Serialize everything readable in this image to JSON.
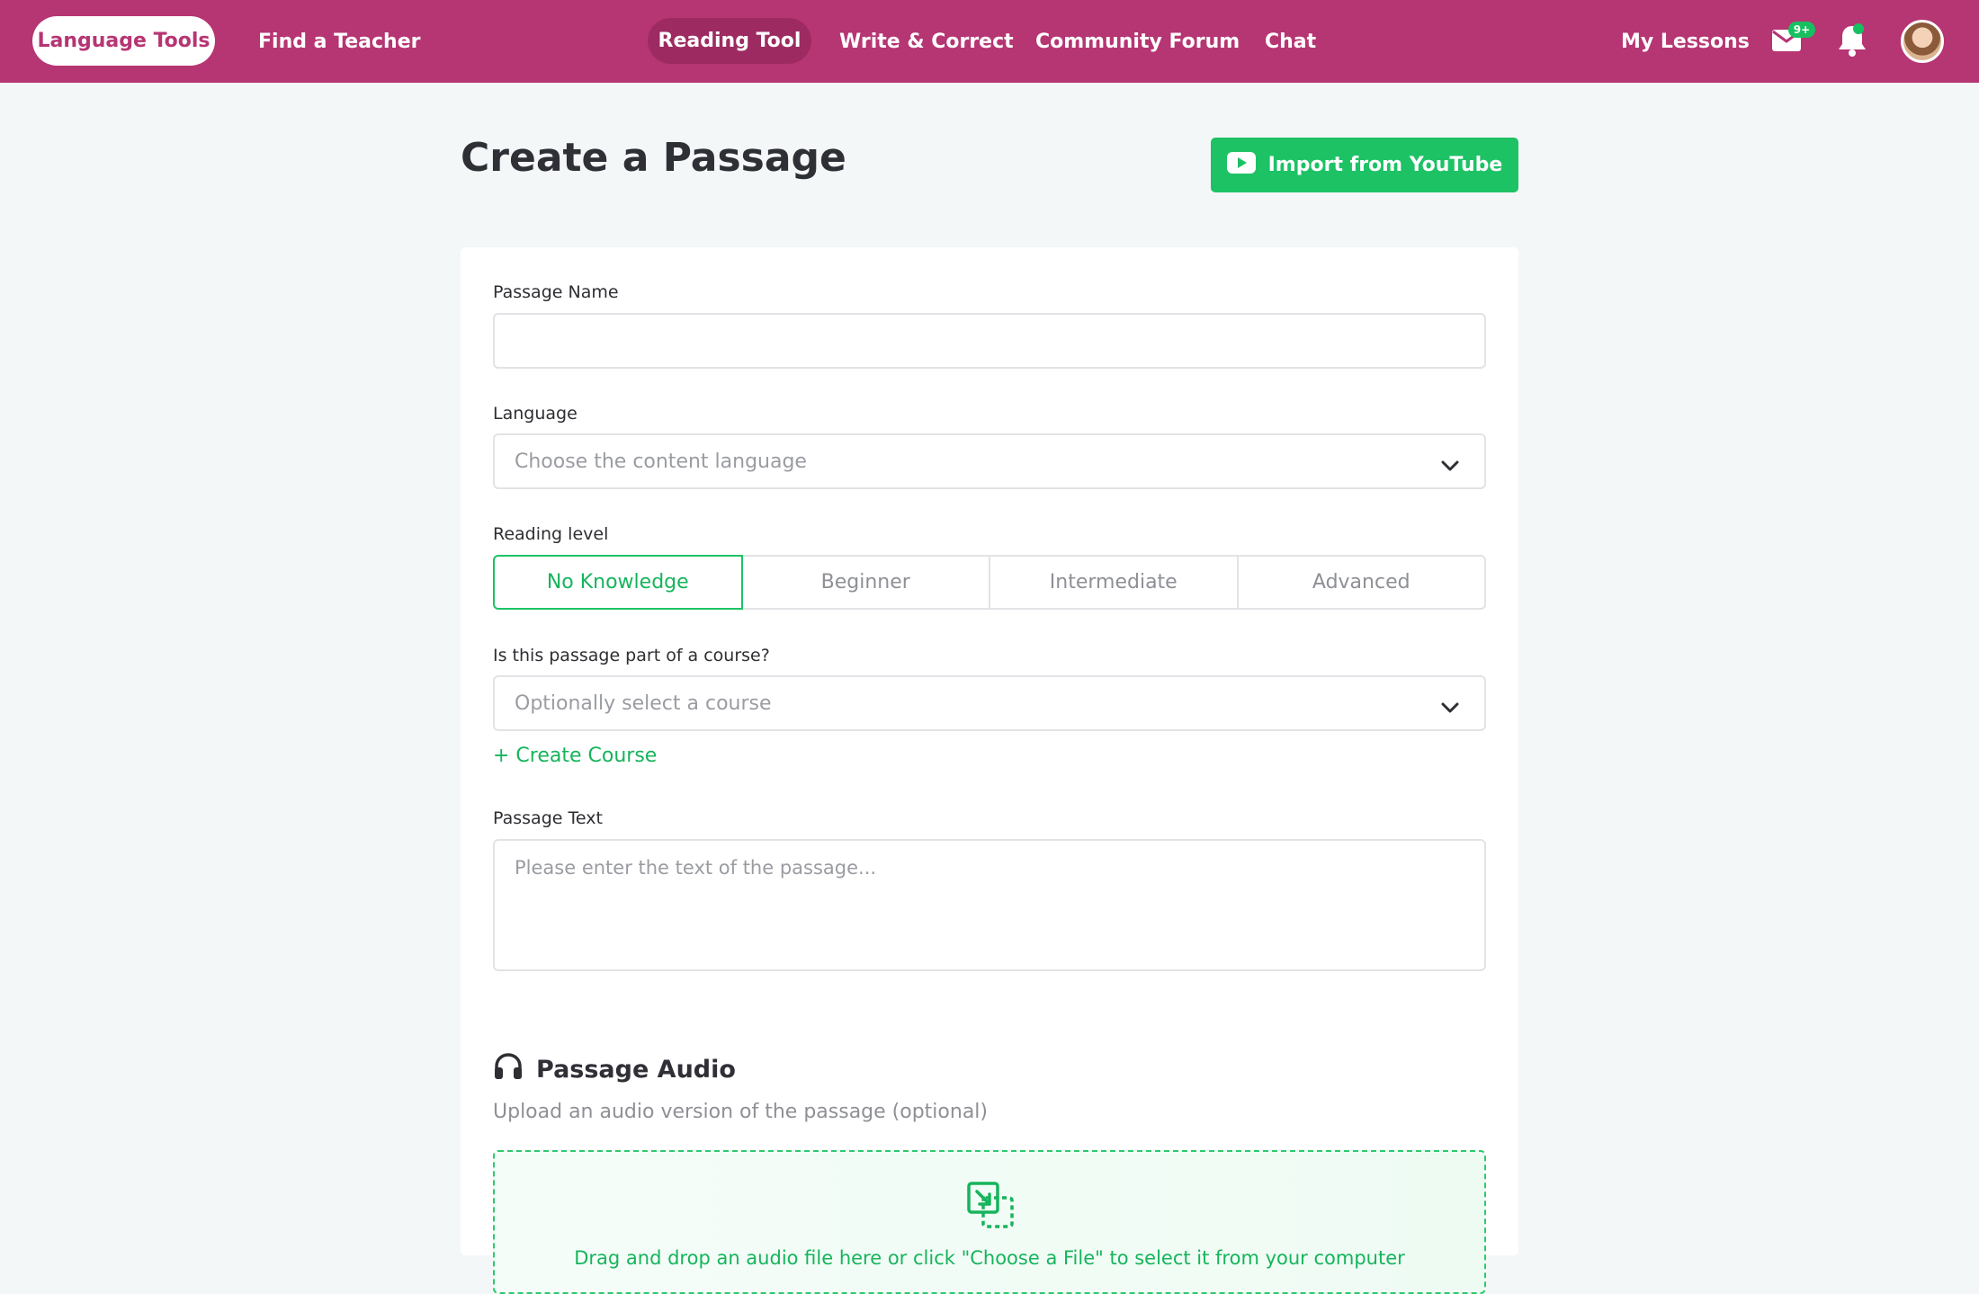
{
  "nav": {
    "brand": "Language Tools",
    "find_teacher": "Find a Teacher",
    "reading_tool": "Reading Tool",
    "write_correct": "Write & Correct",
    "community_forum": "Community Forum",
    "chat": "Chat",
    "my_lessons": "My Lessons",
    "messages_badge": "9+",
    "icons": [
      "mail-icon",
      "bell-icon",
      "avatar"
    ]
  },
  "page": {
    "title": "Create a Passage",
    "import_button": "Import from YouTube"
  },
  "form": {
    "passage_name": {
      "label": "Passage Name",
      "value": "",
      "placeholder": ""
    },
    "language": {
      "label": "Language",
      "placeholder": "Choose the content language"
    },
    "reading_level": {
      "label": "Reading level",
      "options": [
        "No Knowledge",
        "Beginner",
        "Intermediate",
        "Advanced"
      ],
      "selected": "No Knowledge"
    },
    "course": {
      "label": "Is this passage part of a course?",
      "placeholder": "Optionally select a course",
      "create_link": "+ Create Course"
    },
    "passage_text": {
      "label": "Passage Text",
      "placeholder": "Please enter the text of the passage..."
    },
    "audio": {
      "title": "Passage Audio",
      "subtitle": "Upload an audio version of the passage (optional)",
      "dropzone_text": "Drag and drop an audio file here or click \"Choose a File\" to select it from your computer"
    }
  },
  "colors": {
    "nav_bg": "#b63573",
    "nav_active_pill": "#9d2b61",
    "accent_green": "#1dc265",
    "page_bg": "#f4f7f8"
  }
}
